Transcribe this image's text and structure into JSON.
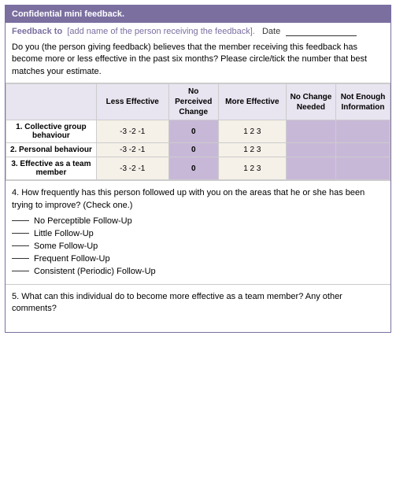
{
  "header": {
    "title": "Confidential mini feedback."
  },
  "feedback_to": {
    "label": "Feedback to",
    "placeholder": "[add name of the person receiving the feedback].",
    "date_label": "Date"
  },
  "description": "Do you (the person giving feedback) believes that the member receiving this feedback has become more or less effective in the past six months?  Please circle/tick the number that best matches your estimate.",
  "table": {
    "headers": {
      "behavior": "",
      "less_effective": "Less Effective",
      "no_perceived_change": "No Perceived Change",
      "more_effective": "More Effective",
      "no_change_needed": "No Change Needed",
      "not_enough_info": "Not Enough Information"
    },
    "scale": {
      "less": [
        "-3",
        "-2",
        "-1"
      ],
      "zero": "0",
      "more": [
        "1",
        "2",
        "3"
      ]
    },
    "rows": [
      {
        "number": "1.",
        "label": "Collective group behaviour"
      },
      {
        "number": "2.",
        "label": "Personal behaviour"
      },
      {
        "number": "3.",
        "label": "Effective as a team member"
      }
    ]
  },
  "followup": {
    "question": "4. How frequently has this person followed up with you on the areas that he or she has been trying to improve? (Check one.)",
    "options": [
      "No Perceptible Follow-Up",
      "Little Follow-Up",
      "Some Follow-Up",
      "Frequent Follow-Up",
      "Consistent (Periodic) Follow-Up"
    ]
  },
  "comments": {
    "text": "5. What can this individual do to become more effective as a team member? Any other comments?"
  }
}
